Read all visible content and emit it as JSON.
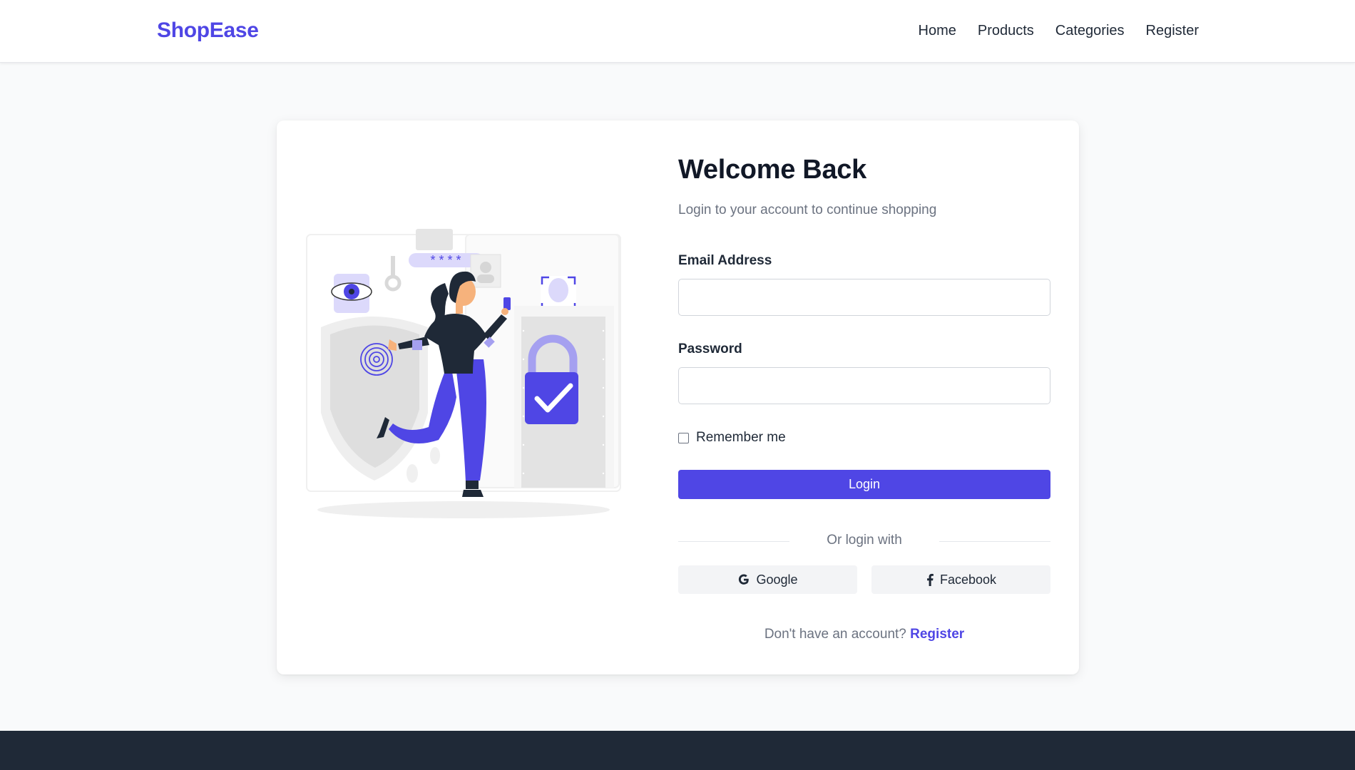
{
  "brand": {
    "name": "ShopEase",
    "color": "#4f46e5"
  },
  "nav": {
    "items": [
      {
        "label": "Home"
      },
      {
        "label": "Products"
      },
      {
        "label": "Categories"
      },
      {
        "label": "Register"
      }
    ]
  },
  "login": {
    "title": "Welcome Back",
    "subtitle": "Login to your account to continue shopping",
    "email_label": "Email Address",
    "email_value": "",
    "password_label": "Password",
    "password_value": "",
    "remember_label": "Remember me",
    "remember_checked": false,
    "submit_label": "Login",
    "divider_text": "Or login with",
    "google_label": "Google",
    "facebook_label": "Facebook",
    "no_account_text": "Don't have an account?",
    "register_link": "Register"
  },
  "colors": {
    "accent": "#4f46e5",
    "footer": "#1f2937",
    "page_bg": "#f9fafb"
  },
  "icons": [
    "google-icon",
    "facebook-icon"
  ],
  "illustration": {
    "masked_password_text": "* * * *"
  }
}
